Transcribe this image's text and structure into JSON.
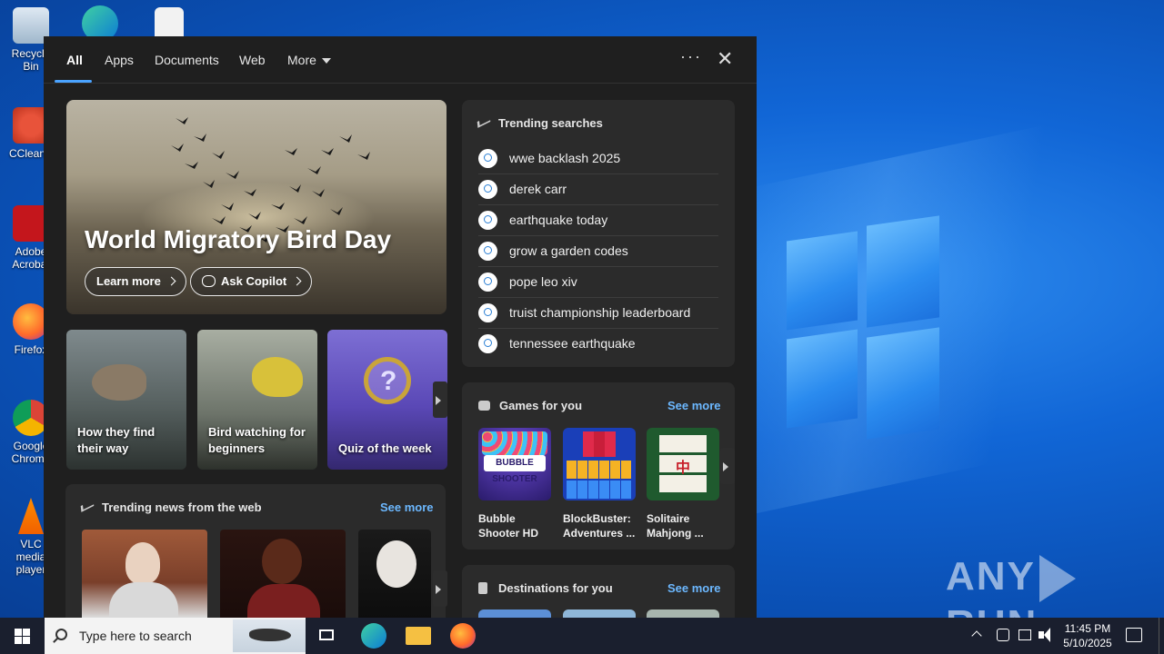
{
  "tabs": [
    {
      "label": "All"
    },
    {
      "label": "Apps"
    },
    {
      "label": "Documents"
    },
    {
      "label": "Web"
    },
    {
      "label": "More"
    }
  ],
  "hero": {
    "title": "World Migratory Bird Day",
    "learn_more": "Learn more",
    "ask_copilot": "Ask Copilot"
  },
  "cards": [
    {
      "label": "How they find their way"
    },
    {
      "label": "Bird watching for beginners"
    },
    {
      "label": "Quiz of the week"
    }
  ],
  "trending": {
    "heading": "Trending searches",
    "items": [
      "wwe backlash 2025",
      "derek carr",
      "earthquake today",
      "grow a garden codes",
      "pope leo xiv",
      "truist championship leaderboard",
      "tennessee earthquake"
    ]
  },
  "games": {
    "heading": "Games for you",
    "see_more": "See more",
    "items": [
      {
        "name": "Bubble Shooter HD"
      },
      {
        "name": "BlockBuster: Adventures ..."
      },
      {
        "name": "Solitaire Mahjong ..."
      }
    ],
    "bubble_logo": "BUBBLE SHOOTER"
  },
  "news": {
    "heading": "Trending news from the web",
    "see_more": "See more"
  },
  "destinations": {
    "heading": "Destinations for you",
    "see_more": "See more"
  },
  "desktop_icons": [
    {
      "label": "Recycle Bin"
    },
    {
      "label": "CCleaner"
    },
    {
      "label": "Adobe Acrobat"
    },
    {
      "label": "Firefox"
    },
    {
      "label": "Google Chrome"
    },
    {
      "label": "VLC media player"
    }
  ],
  "taskbar": {
    "search_placeholder": "Type here to search",
    "time": "11:45 PM",
    "date": "5/10/2025"
  },
  "watermark": "ANY RUN"
}
